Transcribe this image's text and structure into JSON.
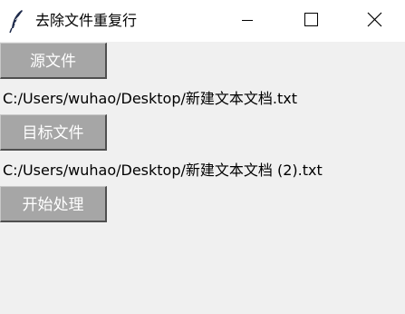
{
  "window": {
    "title": "去除文件重复行",
    "app_icon": "feather-icon",
    "controls": [
      "minimize-icon",
      "maximize-icon",
      "close-icon"
    ]
  },
  "buttons": {
    "source": "源文件",
    "target": "目标文件",
    "start": "开始处理"
  },
  "paths": {
    "source": "C:/Users/wuhao/Desktop/新建文本文档.txt",
    "target": "C:/Users/wuhao/Desktop/新建文本文档 (2).txt"
  },
  "colors": {
    "button_bg": "#a6a6a6",
    "button_text": "#ffffff",
    "window_bg": "#f0f0f0",
    "titlebar_bg": "#ffffff"
  }
}
